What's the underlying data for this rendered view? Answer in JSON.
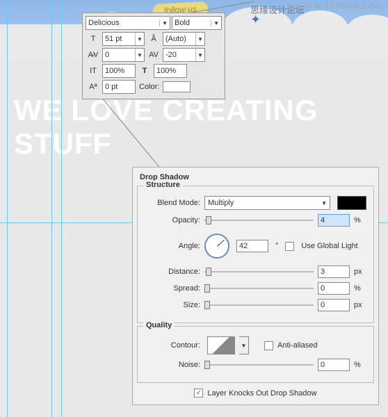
{
  "watermark": {
    "cn": "思缘设计论坛",
    "url": "WWW.MISSYUAN.COM"
  },
  "scene": {
    "follow": "follow us",
    "headline": "WE LOVE CREATING STUFF"
  },
  "char": {
    "font": "Delicious",
    "style": "Bold",
    "size": "51 pt",
    "leading": "(Auto)",
    "kerning": "0",
    "tracking": "-20",
    "vscale": "100%",
    "hscale": "100%",
    "baseline": "0 pt",
    "color_label": "Color:"
  },
  "ds": {
    "panel_title": "Drop Shadow",
    "structure": {
      "legend": "Structure",
      "blend_mode_label": "Blend Mode:",
      "blend_mode": "Multiply",
      "opacity_label": "Opacity:",
      "opacity": "4",
      "opacity_unit": "%",
      "angle_label": "Angle:",
      "angle": "42",
      "angle_unit": "°",
      "global_light": "Use Global Light",
      "distance_label": "Distance:",
      "distance": "3",
      "distance_unit": "px",
      "spread_label": "Spread:",
      "spread": "0",
      "spread_unit": "%",
      "size_label": "Size:",
      "size": "0",
      "size_unit": "px"
    },
    "quality": {
      "legend": "Quality",
      "contour_label": "Contour:",
      "anti_aliased": "Anti-aliased",
      "noise_label": "Noise:",
      "noise": "0",
      "noise_unit": "%"
    },
    "knockout": "Layer Knocks Out Drop Shadow"
  }
}
